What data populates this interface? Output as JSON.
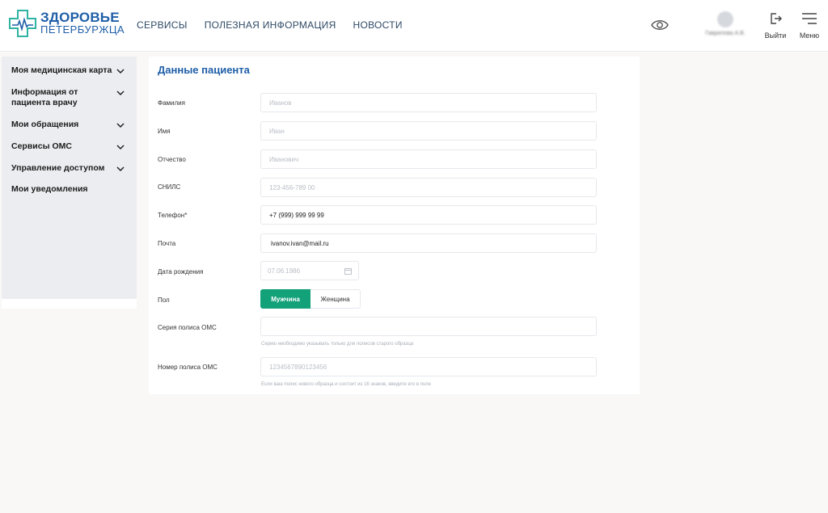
{
  "header": {
    "logo": {
      "line1": "ЗДОРОВЬЕ",
      "line2": "ПЕТЕРБУРЖЦА"
    },
    "nav": [
      {
        "label": "СЕРВИСЫ"
      },
      {
        "label": "ПОЛЕЗНАЯ ИНФОРМАЦИЯ"
      },
      {
        "label": "НОВОСТИ"
      }
    ],
    "user_name": "Гаврилова А.В.",
    "logout_label": "Выйти",
    "menu_label": "Меню"
  },
  "sidebar": {
    "items": [
      {
        "label": "Моя медицинская карта",
        "has_chevron": true
      },
      {
        "label": "Информация от пациента врачу",
        "has_chevron": true
      },
      {
        "label": "Мои обращения",
        "has_chevron": true
      },
      {
        "label": "Сервисы ОМС",
        "has_chevron": true
      },
      {
        "label": "Управление доступом",
        "has_chevron": true
      },
      {
        "label": "Мои уведомления",
        "has_chevron": false
      }
    ]
  },
  "form": {
    "title": "Данные пациента",
    "fields": {
      "surname": {
        "label": "Фамилия",
        "placeholder": "Иванов"
      },
      "name": {
        "label": "Имя",
        "placeholder": "Иван"
      },
      "patronymic": {
        "label": "Отчество",
        "placeholder": "Иванович"
      },
      "snils": {
        "label": "СНИЛС",
        "placeholder": "123-456-789 00"
      },
      "phone": {
        "label": "Телефон*",
        "value": "+7 (999) 999 99 99"
      },
      "email": {
        "label": "Почта",
        "value": "ivanov.ivan@mail.ru"
      },
      "birthdate": {
        "label": "Дата рождения",
        "placeholder": "07.06.1986"
      },
      "gender": {
        "label": "Пол",
        "options": [
          "Мужчина",
          "Женщина"
        ],
        "selected": "Мужчина"
      },
      "oms_series": {
        "label": "Серия полиса ОМС",
        "value": "",
        "hint": "Серию необходимо указывать только для полисов старого образца"
      },
      "oms_number": {
        "label": "Номер полиса ОМС",
        "placeholder": "1234567890123456",
        "hint": "Если ваш полис нового образца и состоит из 16 знаков, введите его в поле"
      }
    }
  },
  "colors": {
    "brand_blue": "#1f5fa8",
    "accent_green": "#13a17a",
    "sidebar_bg": "#ecedf1",
    "page_bg": "#f9f8f6"
  },
  "icons": [
    "eye-icon",
    "avatar",
    "logout-icon",
    "menu-icon",
    "chevron-down-icon",
    "calendar-icon"
  ]
}
